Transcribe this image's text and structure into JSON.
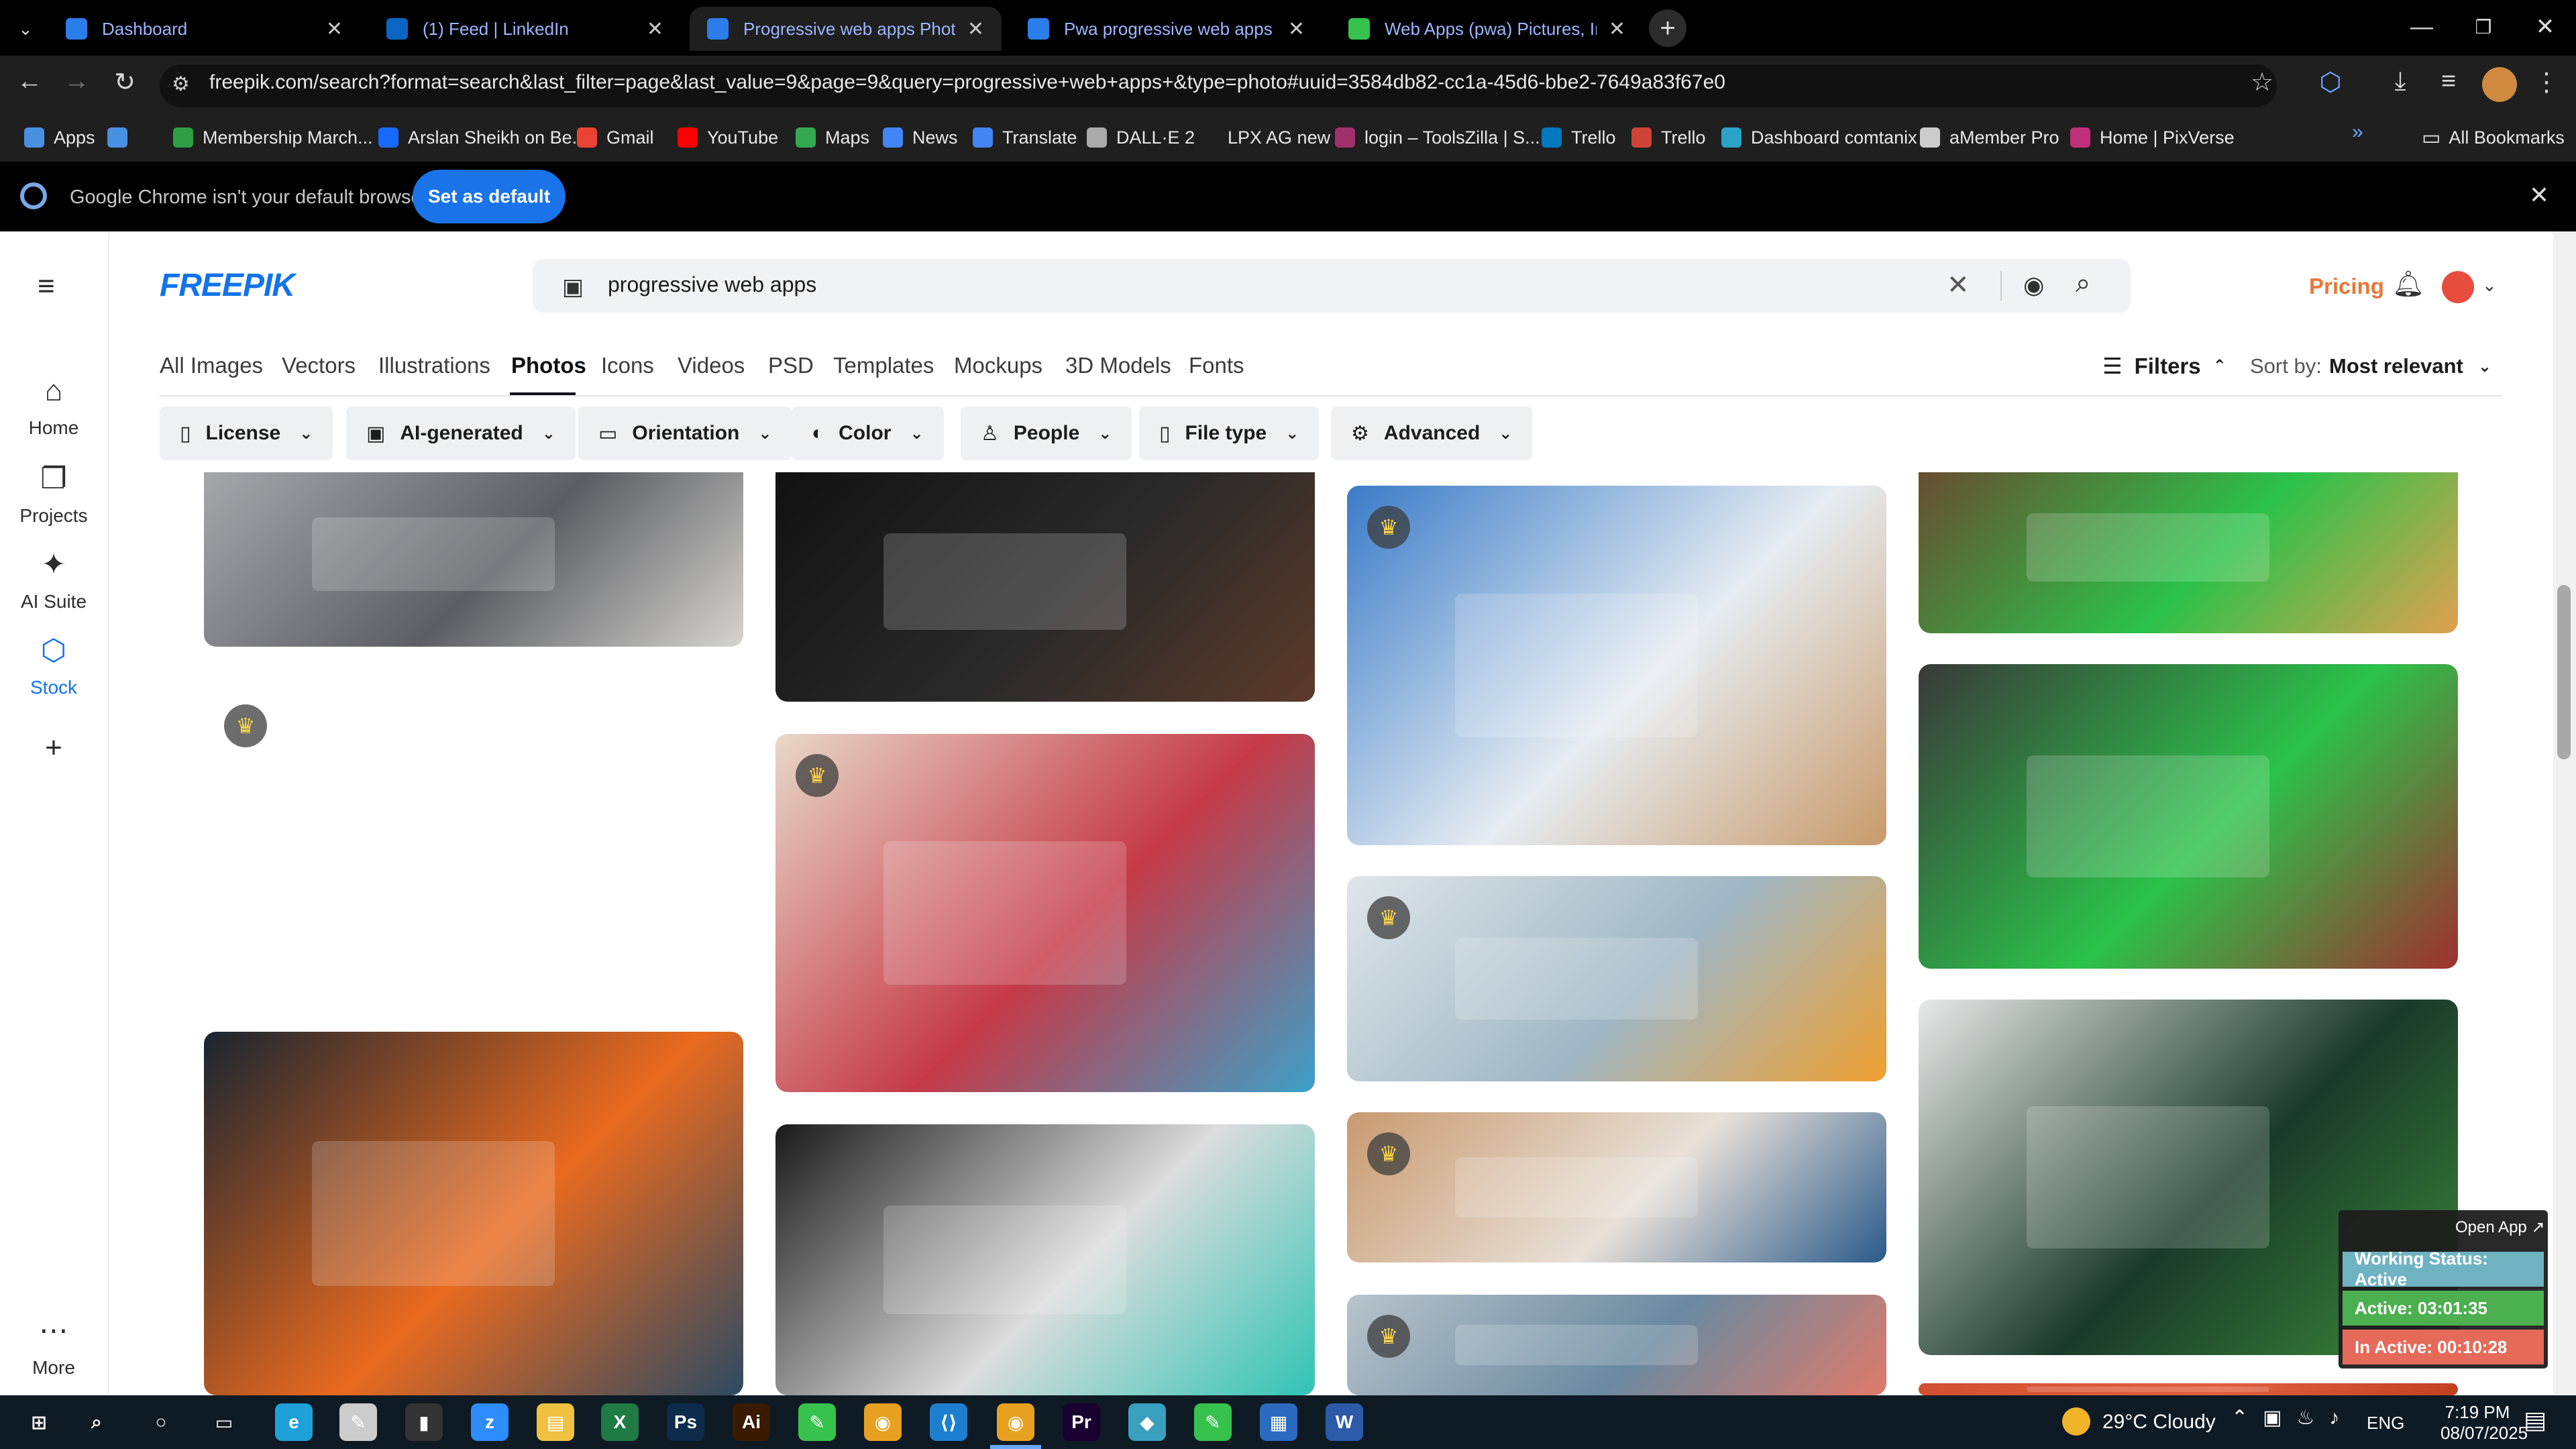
{
  "tabs": [
    {
      "title": "Dashboard",
      "color": "#2b7de9",
      "active": false
    },
    {
      "title": "(1) Feed | LinkedIn",
      "color": "#0a66c2",
      "active": false
    },
    {
      "title": "Progressive web apps Photos | Fr",
      "color": "#2b7de9",
      "active": true
    },
    {
      "title": "Pwa progressive web apps sma",
      "color": "#2b7de9",
      "active": false
    },
    {
      "title": "Web Apps (pwa) Pictures, Imag",
      "color": "#36c24c",
      "active": false
    }
  ],
  "browser": {
    "url": "freepik.com/search?format=search&last_filter=page&last_value=9&page=9&query=progressive+web+apps+&type=photo#uuid=3584db82-cc1a-45d6-bbe2-7649a83f67e0",
    "all_bookmarks_label": "All Bookmarks"
  },
  "bookmarks": [
    {
      "label": "Apps",
      "color": "#4a90e2"
    },
    {
      "label": "",
      "color": "#4a90e2"
    },
    {
      "label": "Membership March...",
      "color": "#2e9e44"
    },
    {
      "label": "Arslan Sheikh on Be...",
      "color": "#1769ff"
    },
    {
      "label": "Gmail",
      "color": "#ea4335"
    },
    {
      "label": "YouTube",
      "color": "#ff0000"
    },
    {
      "label": "Maps",
      "color": "#34a853"
    },
    {
      "label": "News",
      "color": "#4285f4"
    },
    {
      "label": "Translate",
      "color": "#4285f4"
    },
    {
      "label": "DALL·E 2",
      "color": "#aaaaaa"
    },
    {
      "label": "LPX AG new",
      "color": "#1f1f1f"
    },
    {
      "label": "login – ToolsZilla | S...",
      "color": "#a0306a"
    },
    {
      "label": "Trello",
      "color": "#0079bf"
    },
    {
      "label": "Trello",
      "color": "#d04437"
    },
    {
      "label": "Dashboard comtanix",
      "color": "#2aa3c7"
    },
    {
      "label": "aMember Pro",
      "color": "#cccccc"
    },
    {
      "label": "Home | PixVerse",
      "color": "#c0307a"
    }
  ],
  "infobar": {
    "message": "Google Chrome isn't your default browser",
    "button": "Set as default"
  },
  "rail": [
    {
      "label": "Home",
      "icon": "home-icon"
    },
    {
      "label": "Projects",
      "icon": "projects-icon"
    },
    {
      "label": "AI Suite",
      "icon": "sparkle-icon"
    },
    {
      "label": "Stock",
      "icon": "stock-icon"
    },
    {
      "label": "",
      "icon": "plus-icon"
    },
    {
      "label": "More",
      "icon": "more-icon"
    }
  ],
  "header": {
    "logo": "FREEPIK",
    "search_value": "progressive web apps",
    "pricing": "Pricing"
  },
  "categories": [
    "All Images",
    "Vectors",
    "Illustrations",
    "Photos",
    "Icons",
    "Videos",
    "PSD",
    "Templates",
    "Mockups",
    "3D Models",
    "Fonts"
  ],
  "active_category": "Photos",
  "sort": {
    "filters_label": "Filters",
    "sort_label": "Sort by:",
    "sort_value": "Most relevant"
  },
  "chips": [
    "License",
    "AI-generated",
    "Orientation",
    "Color",
    "People",
    "File type",
    "Advanced"
  ],
  "tiles": [
    {
      "name": "laptop-typing-photo",
      "col": 0,
      "premium": false,
      "colors": [
        "#a7a9ad",
        "#5c5e63",
        "#d6d4d0"
      ]
    },
    {
      "name": "businessman-app-cube-photo",
      "col": 0,
      "premium": true,
      "colors": [
        "#ffffff",
        "#ffffff",
        "#ffffff"
      ]
    },
    {
      "name": "man-phone-neon-photo",
      "col": 0,
      "premium": false,
      "colors": [
        "#1a2530",
        "#e96a1f",
        "#2d4a63"
      ]
    },
    {
      "name": "hand-tablet-photo",
      "col": 1,
      "premium": false,
      "colors": [
        "#111111",
        "#2a2a2a",
        "#5c3a2a"
      ]
    },
    {
      "name": "girl-app-cubes-photo",
      "col": 1,
      "premium": true,
      "colors": [
        "#e8d8c8",
        "#c53a48",
        "#3ca0c8"
      ]
    },
    {
      "name": "tablet-tag-photo",
      "col": 1,
      "premium": false,
      "colors": [
        "#1a1a1a",
        "#dcdcdc",
        "#30c4b4"
      ]
    },
    {
      "name": "wireframe-paper-photo",
      "col": 2,
      "premium": true,
      "colors": [
        "#3a7bc8",
        "#e6ecf2",
        "#c89a6a"
      ]
    },
    {
      "name": "laptop-ui-design-photo",
      "col": 2,
      "premium": true,
      "colors": [
        "#dfe6ea",
        "#9fb6c4",
        "#f0a030"
      ]
    },
    {
      "name": "desk-wireframes-photo",
      "col": 2,
      "premium": true,
      "colors": [
        "#c89a70",
        "#e8e0d8",
        "#2a5a8a"
      ]
    },
    {
      "name": "sticky-notes-photo",
      "col": 2,
      "premium": true,
      "colors": [
        "#b9c3cb",
        "#6a8aa0",
        "#e07a6a"
      ]
    },
    {
      "name": "green-screen-desk-photo",
      "col": 3,
      "premium": false,
      "colors": [
        "#6a4a30",
        "#2bc24a",
        "#e0a050"
      ]
    },
    {
      "name": "woman-monitor-photo",
      "col": 3,
      "premium": false,
      "colors": [
        "#3a3a3a",
        "#2bc24a",
        "#a03030"
      ]
    },
    {
      "name": "software-monitor-photo",
      "col": 3,
      "premium": false,
      "colors": [
        "#e8e8e8",
        "#1a3a2a",
        "#3c8c3a"
      ]
    },
    {
      "name": "bottom-orange-photo",
      "col": 3,
      "premium": false,
      "colors": [
        "#d05030",
        "#e06040",
        "#c04020"
      ]
    }
  ],
  "widget": {
    "open_app": "Open App ↗",
    "working_status": "Working Status: Active",
    "active_time": "Active: 03:01:35",
    "inactive_time": "In Active: 00:10:28"
  },
  "taskbar": {
    "weather": "29°C  Cloudy",
    "lang": "ENG",
    "time": "7:19 PM",
    "date": "08/07/2025",
    "apps": [
      {
        "name": "start",
        "color": "#ffffff",
        "glyph": "⊞"
      },
      {
        "name": "search",
        "color": "#ffffff",
        "glyph": "⌕"
      },
      {
        "name": "cortana",
        "color": "#ffffff",
        "glyph": "○"
      },
      {
        "name": "task-view",
        "color": "#ffffff",
        "glyph": "▭"
      },
      {
        "name": "edge",
        "color": "#1ea0d8",
        "glyph": "e"
      },
      {
        "name": "pen",
        "color": "#cccccc",
        "glyph": "✎"
      },
      {
        "name": "terminal",
        "color": "#333333",
        "glyph": "▮"
      },
      {
        "name": "zoom",
        "color": "#2d8cff",
        "glyph": "z"
      },
      {
        "name": "explorer",
        "color": "#f0c040",
        "glyph": "▤"
      },
      {
        "name": "excel",
        "color": "#1f7a44",
        "glyph": "X"
      },
      {
        "name": "photoshop",
        "color": "#0d2b4a",
        "glyph": "Ps"
      },
      {
        "name": "illustrator",
        "color": "#3a1a00",
        "glyph": "Ai"
      },
      {
        "name": "green-app",
        "color": "#36c24c",
        "glyph": "✎"
      },
      {
        "name": "chrome",
        "color": "#e8a020",
        "glyph": "◉"
      },
      {
        "name": "vscode",
        "color": "#1e7fd0",
        "glyph": "⟨⟩"
      },
      {
        "name": "chrome-active",
        "color": "#e8a020",
        "glyph": "◉"
      },
      {
        "name": "premiere",
        "color": "#1a0030",
        "glyph": "Pr"
      },
      {
        "name": "blue-app",
        "color": "#3aa0c0",
        "glyph": "◆"
      },
      {
        "name": "green-app-2",
        "color": "#36c24c",
        "glyph": "✎"
      },
      {
        "name": "calculator",
        "color": "#2a6ac0",
        "glyph": "▦"
      },
      {
        "name": "word",
        "color": "#2b5aa8",
        "glyph": "W"
      }
    ]
  }
}
